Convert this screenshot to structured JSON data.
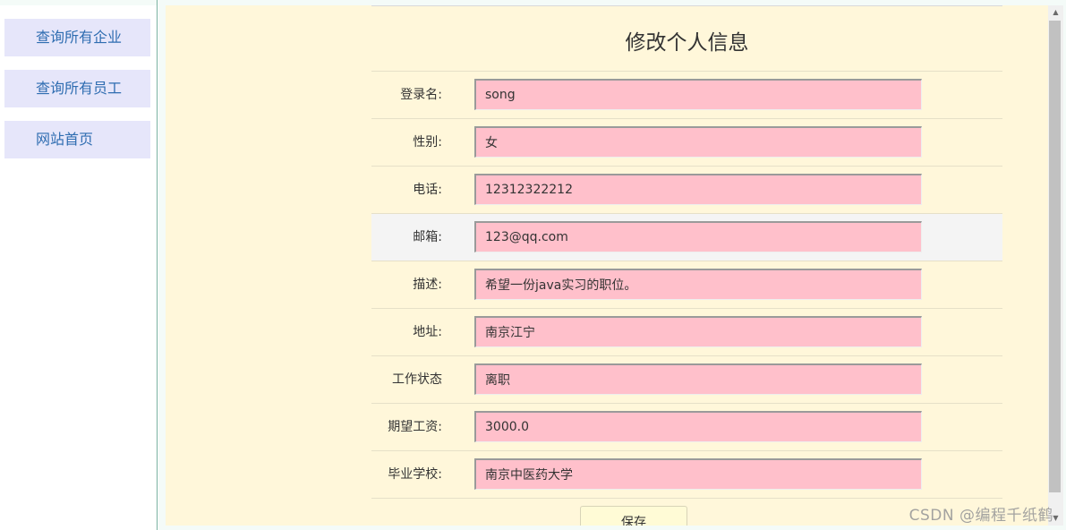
{
  "sidebar": {
    "items": [
      {
        "label": "查询所有企业"
      },
      {
        "label": "查询所有员工"
      },
      {
        "label": "网站首页"
      }
    ]
  },
  "form": {
    "title": "修改个人信息",
    "fields": [
      {
        "label": "登录名:",
        "value": "song"
      },
      {
        "label": "性别:",
        "value": "女"
      },
      {
        "label": "电话:",
        "value": "12312322212"
      },
      {
        "label": "邮箱:",
        "value": "123@qq.com"
      },
      {
        "label": "描述:",
        "value": "希望一份java实习的职位。"
      },
      {
        "label": "地址:",
        "value": "南京江宁"
      },
      {
        "label": "工作状态",
        "value": "离职"
      },
      {
        "label": "期望工资:",
        "value": "3000.0"
      },
      {
        "label": "毕业学校:",
        "value": "南京中医药大学"
      }
    ],
    "save_label": "保存"
  },
  "watermark": "CSDN @编程千纸鹤",
  "colors": {
    "content_bg": "#fff7da",
    "input_bg": "#ffc0cb",
    "nav_bg": "#e6e6fa",
    "nav_text": "#2f6db1"
  }
}
